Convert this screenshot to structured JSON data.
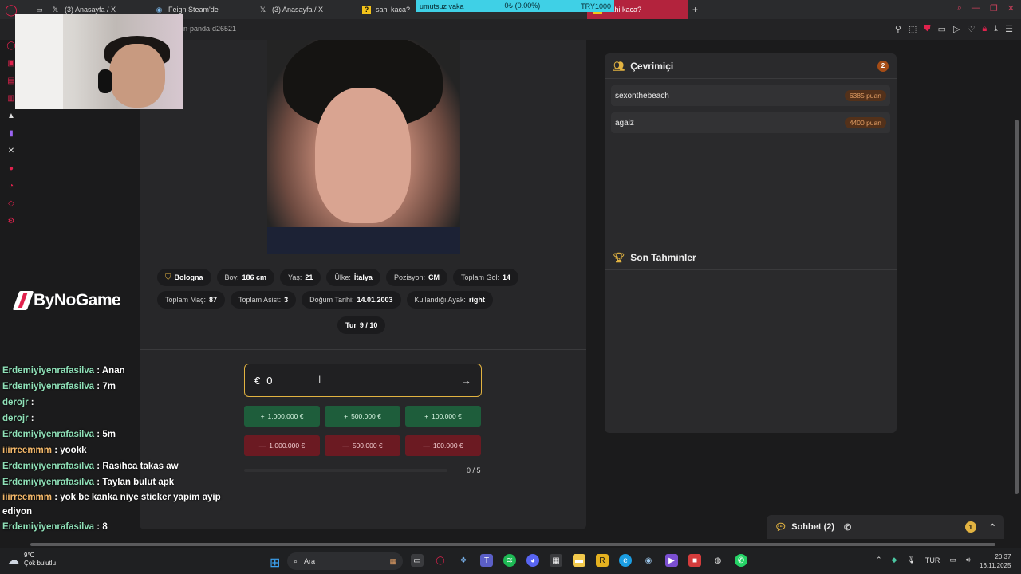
{
  "browser": {
    "tabs": [
      {
        "title": "(3) Anasayfa / X",
        "icon": "x-icon"
      },
      {
        "title": "Feign Steam'de",
        "icon": "steam-icon"
      },
      {
        "title": "(3) Anasayfa / X",
        "icon": "x-icon"
      },
      {
        "title": "sahi kaca?",
        "icon": "question-icon"
      }
    ],
    "active_tab": {
      "title": "sahi kaca?",
      "icon": "question-icon"
    },
    "ticker": {
      "left": "umutsuz vaka",
      "middle": "0₺ (0.00%)",
      "right": "TRY1000"
    },
    "url_fragment": "n-panda-d26521"
  },
  "player": {
    "chips_row1": [
      {
        "label": "",
        "value": "Bologna",
        "icon": "shield-icon"
      },
      {
        "label": "Boy:",
        "value": "186 cm"
      },
      {
        "label": "Yaş:",
        "value": "21"
      },
      {
        "label": "Ülke:",
        "value": "İtalya"
      },
      {
        "label": "Pozisyon:",
        "value": "CM"
      },
      {
        "label": "Toplam Gol:",
        "value": "14"
      }
    ],
    "chips_row2": [
      {
        "label": "Toplam Maç:",
        "value": "87"
      },
      {
        "label": "Toplam Asist:",
        "value": "3"
      },
      {
        "label": "Doğum Tarihi:",
        "value": "14.01.2003"
      },
      {
        "label": "Kullandığı Ayak:",
        "value": "right"
      }
    ],
    "round": {
      "label": "Tur",
      "value": "9 / 10"
    }
  },
  "guess": {
    "currency": "€",
    "value": "0",
    "plus_buttons": [
      "1.000.000 €",
      "500.000 €",
      "100.000 €"
    ],
    "minus_buttons": [
      "1.000.000 €",
      "500.000 €",
      "100.000 €"
    ],
    "progress": {
      "text": "0 / 5",
      "fraction": 0.0
    }
  },
  "online": {
    "title": "Çevrimiçi",
    "count": "2",
    "users": [
      {
        "name": "sexonthebeach",
        "points": "6385 puan"
      },
      {
        "name": "agaiz",
        "points": "4400 puan"
      }
    ]
  },
  "recent": {
    "title": "Son Tahminler"
  },
  "sponsor": {
    "name": "ByNoGame"
  },
  "chat": [
    {
      "user": "Erdemiyiyenrafasilva",
      "msg": "Anan",
      "color": "green"
    },
    {
      "user": "Erdemiyiyenrafasilva",
      "msg": "7m",
      "color": "green"
    },
    {
      "user": "derojr",
      "msg": "",
      "color": "green"
    },
    {
      "user": "derojr",
      "msg": "",
      "color": "green"
    },
    {
      "user": "Erdemiyiyenrafasilva",
      "msg": "5m",
      "color": "green"
    },
    {
      "user": "iiirreemmm",
      "msg": "yookk",
      "color": "orange"
    },
    {
      "user": "Erdemiyiyenrafasilva",
      "msg": "Rasihca takas aw",
      "color": "green"
    },
    {
      "user": "Erdemiyiyenrafasilva",
      "msg": "Taylan bulut apk",
      "color": "green"
    },
    {
      "user": "iiirreemmm",
      "msg": "yok be kanka niye sticker yapim ayip ediyon",
      "color": "orange"
    },
    {
      "user": "Erdemiyiyenrafasilva",
      "msg": "8",
      "color": "green"
    }
  ],
  "sohbet": {
    "label": "Sohbet (2)",
    "notif": "1"
  },
  "taskbar": {
    "weather_temp": "9°C",
    "weather_desc": "Çok bulutlu",
    "search_label": "Ara",
    "lang": "TUR",
    "time": "20:37",
    "date": "16.11.2025"
  },
  "colors": {
    "accent": "#e2b341",
    "plus": "#1e5d3b",
    "minus": "#6b1a22",
    "brand": "#e0224d"
  }
}
